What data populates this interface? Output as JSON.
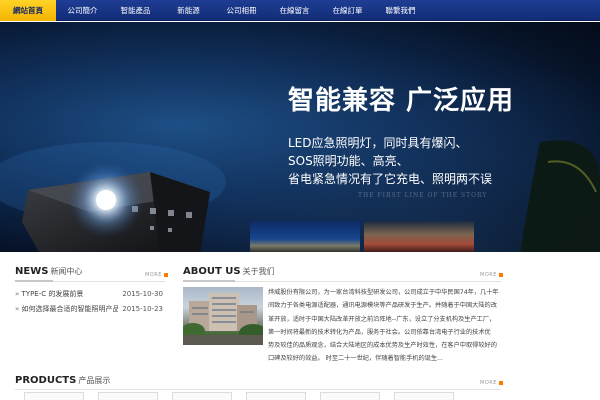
{
  "nav": {
    "items": [
      {
        "label": "網站首頁",
        "active": true
      },
      {
        "label": "公司簡介"
      },
      {
        "label": "智能產品"
      },
      {
        "label": "新能源"
      },
      {
        "label": "公司相冊"
      },
      {
        "label": "在線留言"
      },
      {
        "label": "在線訂單"
      },
      {
        "label": "聯繫我們"
      }
    ]
  },
  "banner": {
    "headline": "智能兼容  广泛应用",
    "lines": [
      "LED应急照明灯，同时具有爆闪、",
      "SOS照明功能、高亮、",
      "省电紧急情况有了它充电、照明两不误"
    ],
    "watermark": "THE FIRST LINE OF THE STORY",
    "slide_count": 8,
    "active_slide": 1
  },
  "news": {
    "title_en": "NEWS",
    "title_cn": "新闻中心",
    "more": "MORE",
    "items": [
      {
        "title": "TYPE-C 的发展前景",
        "date": "2015-10-30"
      },
      {
        "title": "如何选择最合适的智能照明产品",
        "date": "2015-10-23"
      }
    ]
  },
  "about": {
    "title_en": "ABOUT US",
    "title_cn": "关于我们",
    "more": "MORE",
    "lines": [
      "烨威股份有限公司，为一家台湾科技型研发公司，公司成立于中华民国74年，几十年",
      "间致力于各类电源适配器，通讯电源模块等产品研发于生产。并随着于中国大陆的改",
      "革开放，适时于中国大陆改革开放之前沿阵地--广东，设立了分支机构及生产工厂，",
      "第一时间将最新的技术转化为产品，服务于社会。公司依靠台湾电子行业的技术优",
      "势及较佳的品质观念，结合大陆地区的成本优势及生产时效性，在客户中取得较好的",
      "口碑及较好的效益。 时至二十一世纪，伴随着智能手机的诞生..."
    ]
  },
  "products": {
    "title_en": "PRODUCTS",
    "title_cn": "产品展示",
    "more": "MORE"
  },
  "colors": {
    "nav_bg": "#1a3687",
    "nav_active": "#f7c20f",
    "accent": "#ff7a00"
  }
}
